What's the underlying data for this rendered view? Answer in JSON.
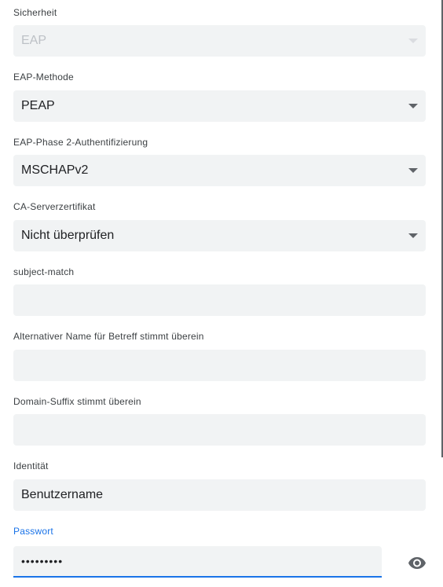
{
  "sections": {
    "security": {
      "label": "Sicherheit",
      "value": "EAP"
    },
    "eap_method": {
      "label": "EAP-Methode",
      "value": "PEAP"
    },
    "phase2": {
      "label": "EAP-Phase 2-Authentifizierung",
      "value": "MSCHAPv2"
    },
    "ca_cert": {
      "label": "CA-Serverzertifikat",
      "value": "Nicht überprüfen"
    },
    "subject_match": {
      "label": "subject-match",
      "value": ""
    },
    "alt_name": {
      "label": "Alternativer Name für Betreff stimmt überein",
      "value": ""
    },
    "domain_suffix": {
      "label": "Domain-Suffix stimmt überein",
      "value": ""
    },
    "identity": {
      "label": "Identität",
      "value": "Benutzername"
    },
    "password": {
      "label": "Passwort",
      "value": "•••••••••"
    }
  },
  "icons": {
    "dropdown": "chevron-down-icon",
    "password_toggle": "eye-icon"
  },
  "colors": {
    "accent": "#1a73e8",
    "field_bg": "#f1f3f4"
  }
}
